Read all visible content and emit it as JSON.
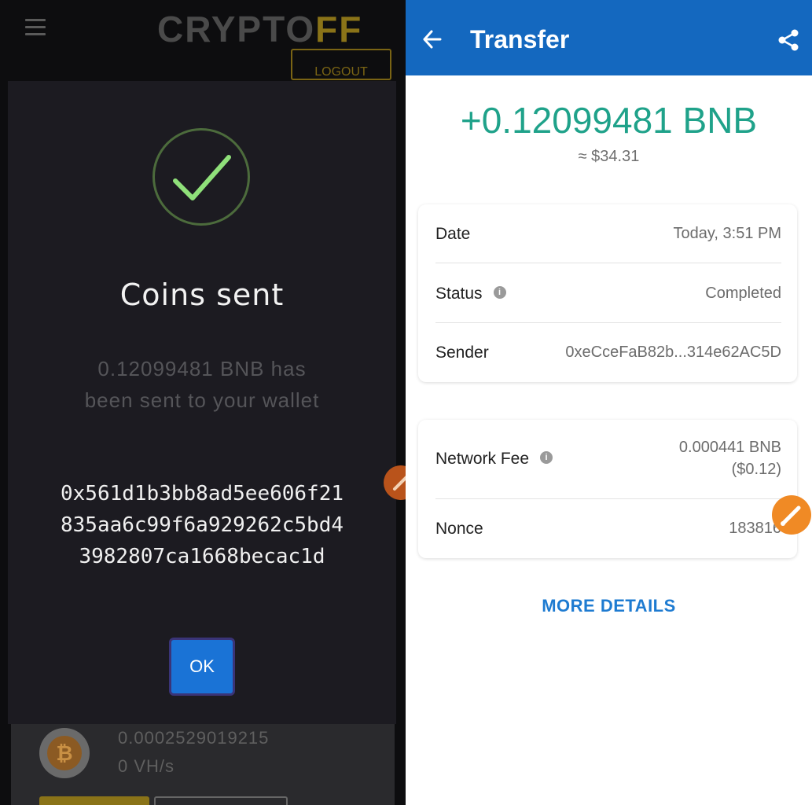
{
  "left": {
    "brand": {
      "main": "CRYPTO",
      "accent": "FF"
    },
    "logout_label": "LOGOUT",
    "modal": {
      "title": "Coins sent",
      "message": "0.12099481 BNB has been sent to your wallet",
      "tx_hash": "0x561d1b3bb8ad5ee606f21835aa6c99f6a929262c5bd43982807ca1668becac1d",
      "ok_label": "OK"
    },
    "bitcoin_row": {
      "coin_symbol": "₿",
      "amount": "0.0002529019215",
      "rate": "0 VH/s"
    }
  },
  "right": {
    "title": "Transfer",
    "amount": "+0.12099481 BNB",
    "fiat_value": "≈ $34.31",
    "details": {
      "date_label": "Date",
      "date_value": "Today, 3:51 PM",
      "status_label": "Status",
      "status_value": "Completed",
      "sender_label": "Sender",
      "sender_value": "0xeCceFaB82b...314e62AC5D"
    },
    "fees": {
      "fee_label": "Network Fee",
      "fee_value": "0.000441 BNB",
      "fee_fiat": "($0.12)",
      "nonce_label": "Nonce",
      "nonce_value": "183816"
    },
    "more_details_label": "MORE DETAILS"
  },
  "colors": {
    "accent_blue": "#1468bf",
    "amount_green": "#1fa28a",
    "brand_gold": "#8a7318",
    "ok_blue": "#1a73d6"
  },
  "icons": [
    "menu-icon",
    "checkmark-icon",
    "bitcoin-icon",
    "back-arrow-icon",
    "share-icon",
    "info-icon",
    "edit-icon"
  ]
}
